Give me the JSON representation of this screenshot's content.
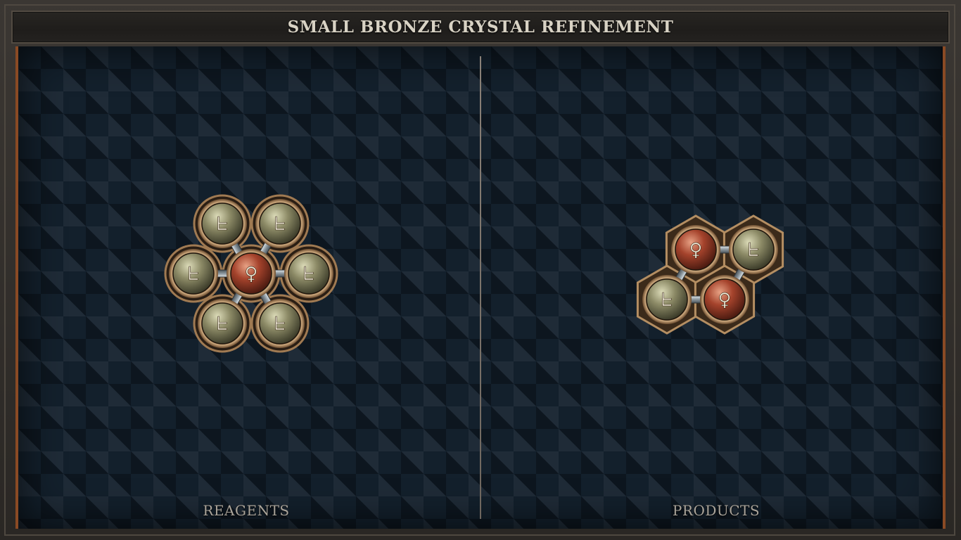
{
  "title": "SMALL BRONZE CRYSTAL REFINEMENT",
  "panels": {
    "reagents_label": "REAGENTS",
    "products_label": "PRODUCTS"
  },
  "symbols": {
    "salt": "ᖶ",
    "copper": "♀"
  },
  "reagent_molecule": {
    "atoms": [
      "copper",
      "salt",
      "salt",
      "salt",
      "salt",
      "salt",
      "salt"
    ],
    "bonds": [
      [
        0,
        1
      ],
      [
        0,
        2
      ],
      [
        0,
        3
      ],
      [
        0,
        4
      ],
      [
        0,
        5
      ],
      [
        0,
        6
      ]
    ]
  },
  "product_molecule": {
    "atoms": [
      "copper",
      "salt",
      "salt",
      "copper"
    ],
    "bonds": [
      [
        0,
        1
      ],
      [
        0,
        2
      ],
      [
        1,
        3
      ],
      [
        2,
        3
      ]
    ]
  },
  "colors": {
    "copper_atom": "#a5432c",
    "salt_atom": "#8c8a66",
    "bronze_rim": "#b48e62",
    "panel_edge": "#8a4a24"
  }
}
